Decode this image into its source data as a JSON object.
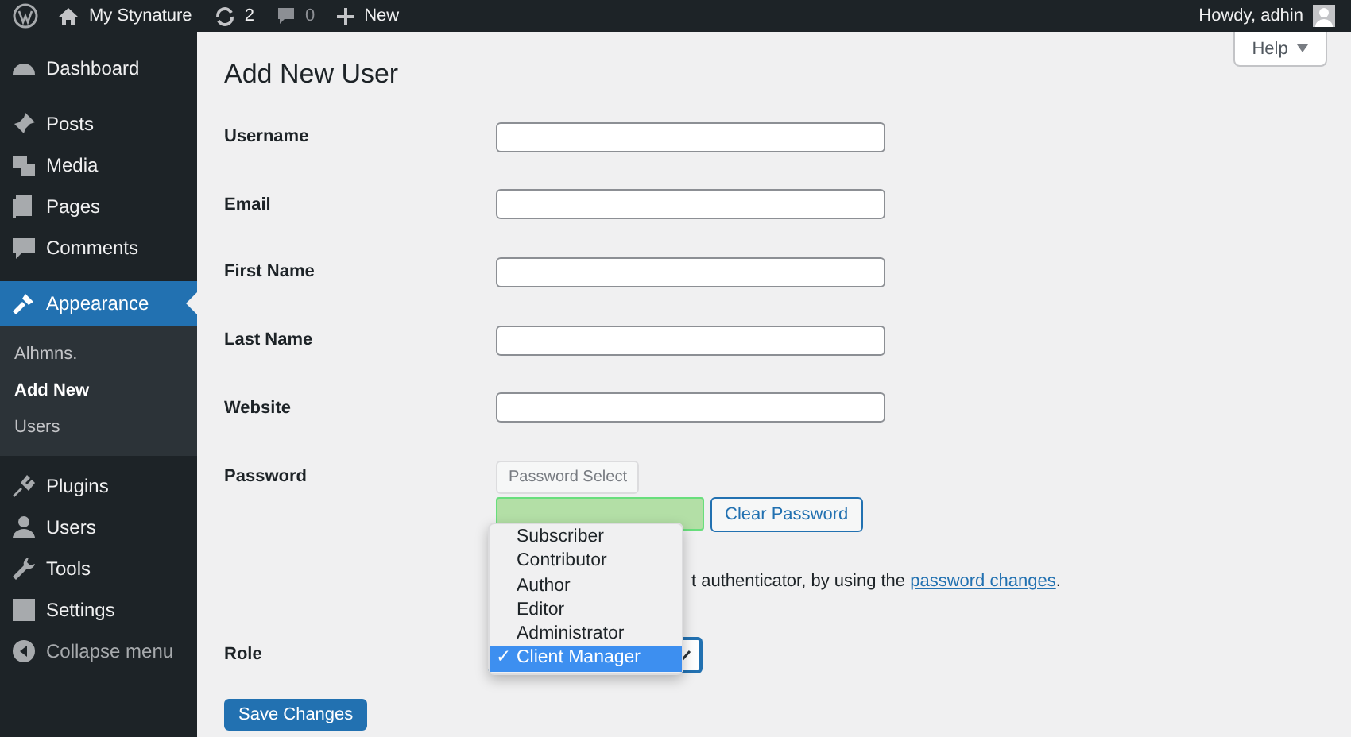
{
  "admin_bar": {
    "site_name": "My Stynature",
    "updates": "2",
    "comments": "0",
    "new": "New",
    "greeting": "Howdy, adhin"
  },
  "sidebar": {
    "items": [
      {
        "label": "Dashboard",
        "selected": false
      },
      {
        "label": "Posts",
        "selected": false
      },
      {
        "label": "Media",
        "selected": false
      },
      {
        "label": "Pages",
        "selected": false
      },
      {
        "label": "Comments",
        "selected": false
      },
      {
        "label": "Appearance",
        "selected": true,
        "children": [
          {
            "label": "Alhmns.",
            "selected": false
          },
          {
            "label": "Add New",
            "selected": true
          },
          {
            "label": "Users",
            "selected": false
          }
        ]
      },
      {
        "label": "Plugins",
        "selected": false
      },
      {
        "label": "Users",
        "selected": false
      },
      {
        "label": "Tools",
        "selected": false
      },
      {
        "label": "Settings",
        "selected": false
      }
    ],
    "collapse": "Collapse menu"
  },
  "help_button": "Help",
  "page_title": "Add New User",
  "fields": [
    {
      "label": "Username"
    },
    {
      "label": "Email"
    },
    {
      "label": "First Name"
    },
    {
      "label": "Last Name"
    },
    {
      "label": "Website"
    }
  ],
  "password": {
    "label": "Password",
    "select_button": "Password Select",
    "clear_button": "Clear Password",
    "hint": "t authenticator, by using the",
    "hint_link": "password changes",
    "hint_end": "."
  },
  "role": {
    "label": "Role",
    "expanded": true,
    "options": [
      {
        "label": "Subscriber",
        "selected": false
      },
      {
        "label": "Contributor",
        "selected": false
      },
      {
        "label": "Author",
        "selected": false
      },
      {
        "label": "Editor",
        "selected": false
      },
      {
        "label": "Administrator",
        "selected": false
      },
      {
        "label": "Client Manager",
        "selected": true
      }
    ],
    "check": "✓"
  },
  "save_button": "Save Changes"
}
